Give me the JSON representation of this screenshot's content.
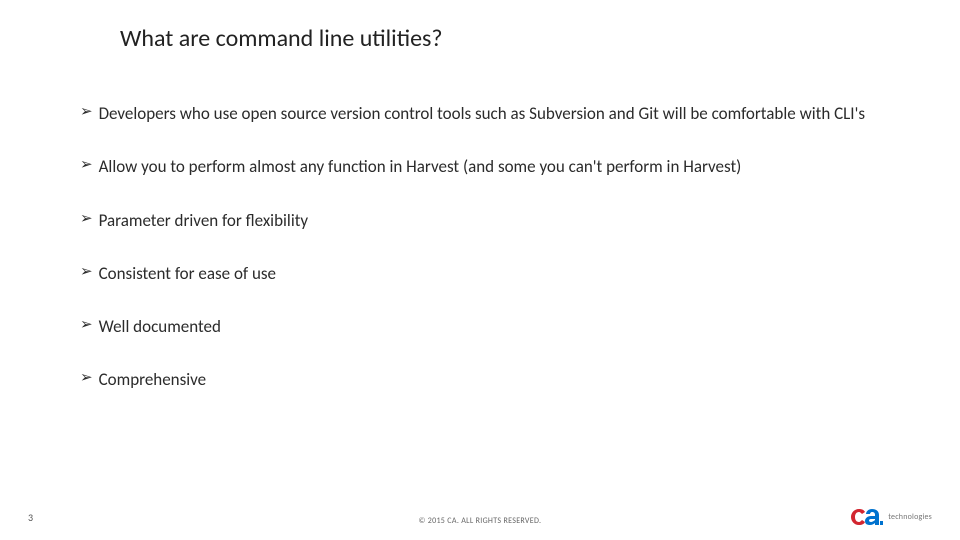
{
  "slide": {
    "title": "What are command line utilities?",
    "bullets": [
      "Developers who use open source version control tools such as Subversion and Git will be comfortable with CLI's",
      "Allow you to perform almost any function in Harvest (and some you can't perform in Harvest)",
      "Parameter driven for flexibility",
      "Consistent for ease of use",
      "Well documented",
      "Comprehensive"
    ],
    "bullet_marker": "➢"
  },
  "footer": {
    "page_number": "3",
    "copyright": "© 2015 CA. ALL RIGHTS RESERVED.",
    "logo_subtext": "technologies"
  },
  "colors": {
    "logo_red": "#d22630",
    "logo_blue": "#0072ce"
  }
}
